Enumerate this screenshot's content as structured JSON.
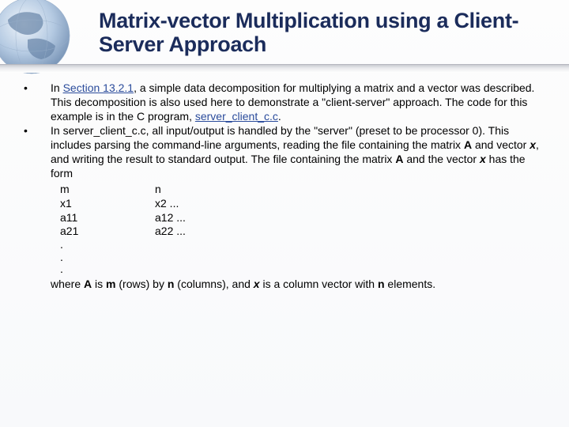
{
  "title": "Matrix-vector Multiplication using a Client-Server Approach",
  "bullets": [
    {
      "pre": "In ",
      "link": "Section 13.2.1",
      "post1": ", a simple data decomposition for multiplying a matrix and a vector was described. This decomposition is also used here to demonstrate a \"client-server\" approach. The code for this example is in the C program, ",
      "link2": "server_client_c.c",
      "post2": "."
    },
    {
      "text": "In server_client_c.c, all input/output is handled by the \"server\" (preset to be processor 0). This includes parsing the command-line arguments, reading the file containing the matrix ",
      "boldA": "A",
      "mid1": " and vector ",
      "boldX": "x",
      "mid2": ", and writing the result to standard output. The file containing the matrix ",
      "boldA2": "A",
      "mid3": " and the vector ",
      "boldX2": "x",
      "mid4": " has the form"
    }
  ],
  "table": [
    {
      "a": "m",
      "b": "n"
    },
    {
      "a": "x1",
      "b": "x2 ..."
    },
    {
      "a": "a11",
      "b": "a12 ..."
    },
    {
      "a": "a21",
      "b": "a22 ..."
    }
  ],
  "dots": [
    ".",
    ".",
    "."
  ],
  "final": {
    "t1": "where ",
    "A": "A",
    "t2": " is ",
    "m": "m",
    "t3": " (rows) by ",
    "n": "n",
    "t4": " (columns), and ",
    "x": "x",
    "t5": " is a column vector with ",
    "n2": "n",
    "t6": " elements."
  }
}
